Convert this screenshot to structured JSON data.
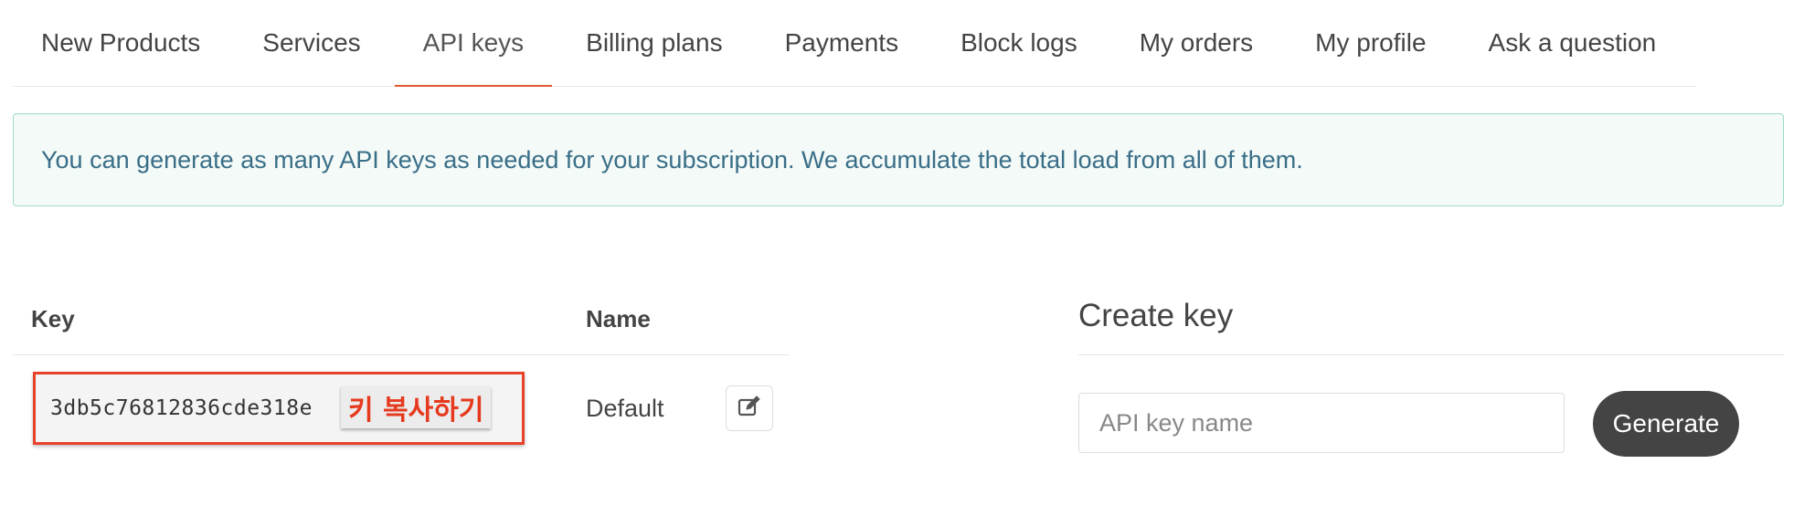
{
  "tabs": [
    {
      "label": "New Products",
      "active": false
    },
    {
      "label": "Services",
      "active": false
    },
    {
      "label": "API keys",
      "active": true
    },
    {
      "label": "Billing plans",
      "active": false
    },
    {
      "label": "Payments",
      "active": false
    },
    {
      "label": "Block logs",
      "active": false
    },
    {
      "label": "My orders",
      "active": false
    },
    {
      "label": "My profile",
      "active": false
    },
    {
      "label": "Ask a question",
      "active": false
    }
  ],
  "alert": {
    "text": "You can generate as many API keys as needed for your subscription. We accumulate the total load from all of them."
  },
  "keys_table": {
    "headers": {
      "key": "Key",
      "name": "Name"
    },
    "rows": [
      {
        "key": "3db5c76812836cde318e",
        "overlay_label": "키 복사하기",
        "name": "Default",
        "edit_icon": "edit-icon"
      }
    ]
  },
  "create_key": {
    "title": "Create key",
    "input_placeholder": "API key name",
    "input_value": "",
    "button_label": "Generate"
  },
  "colors": {
    "active_tab_underline": "#e4572e",
    "alert_background": "#f3faf7",
    "alert_border": "#9fd9c6",
    "alert_text": "#3a6e88",
    "highlight_border": "#e8422a",
    "overlay_text": "#e63a1f",
    "button_background": "#444444"
  }
}
